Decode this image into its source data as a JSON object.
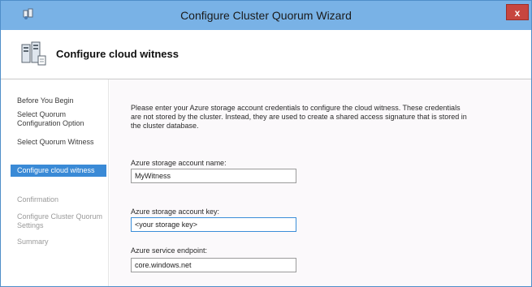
{
  "window": {
    "title": "Configure Cluster Quorum Wizard",
    "close_label": "x"
  },
  "header": {
    "title": "Configure cloud witness"
  },
  "sidebar": {
    "items": [
      {
        "label": "Before You Begin",
        "state": "normal"
      },
      {
        "label": "Select Quorum Configuration Option",
        "state": "normal"
      },
      {
        "label": "Select Quorum Witness",
        "state": "normal"
      },
      {
        "label": "Configure cloud witness",
        "state": "active"
      },
      {
        "label": "Confirmation",
        "state": "disabled"
      },
      {
        "label": "Configure Cluster Quorum Settings",
        "state": "disabled"
      },
      {
        "label": "Summary",
        "state": "disabled"
      }
    ]
  },
  "main": {
    "intro": "Please enter your Azure storage account credentials to configure the cloud witness. These credentials are not stored by the cluster. Instead, they are used to create a shared access signature that is stored in the cluster database.",
    "fields": [
      {
        "label": "Azure storage account name:",
        "value": "MyWitness"
      },
      {
        "label": "Azure storage account key:",
        "value": "<your storage key>"
      },
      {
        "label": "Azure service endpoint:",
        "value": "core.windows.net"
      }
    ]
  },
  "colors": {
    "titlebar": "#79b2e6",
    "active_nav": "#3a8ad6",
    "close_button": "#c7463f"
  },
  "icons": {
    "app": "cluster-app-icon",
    "header": "cluster-servers-icon",
    "close": "close-icon"
  }
}
